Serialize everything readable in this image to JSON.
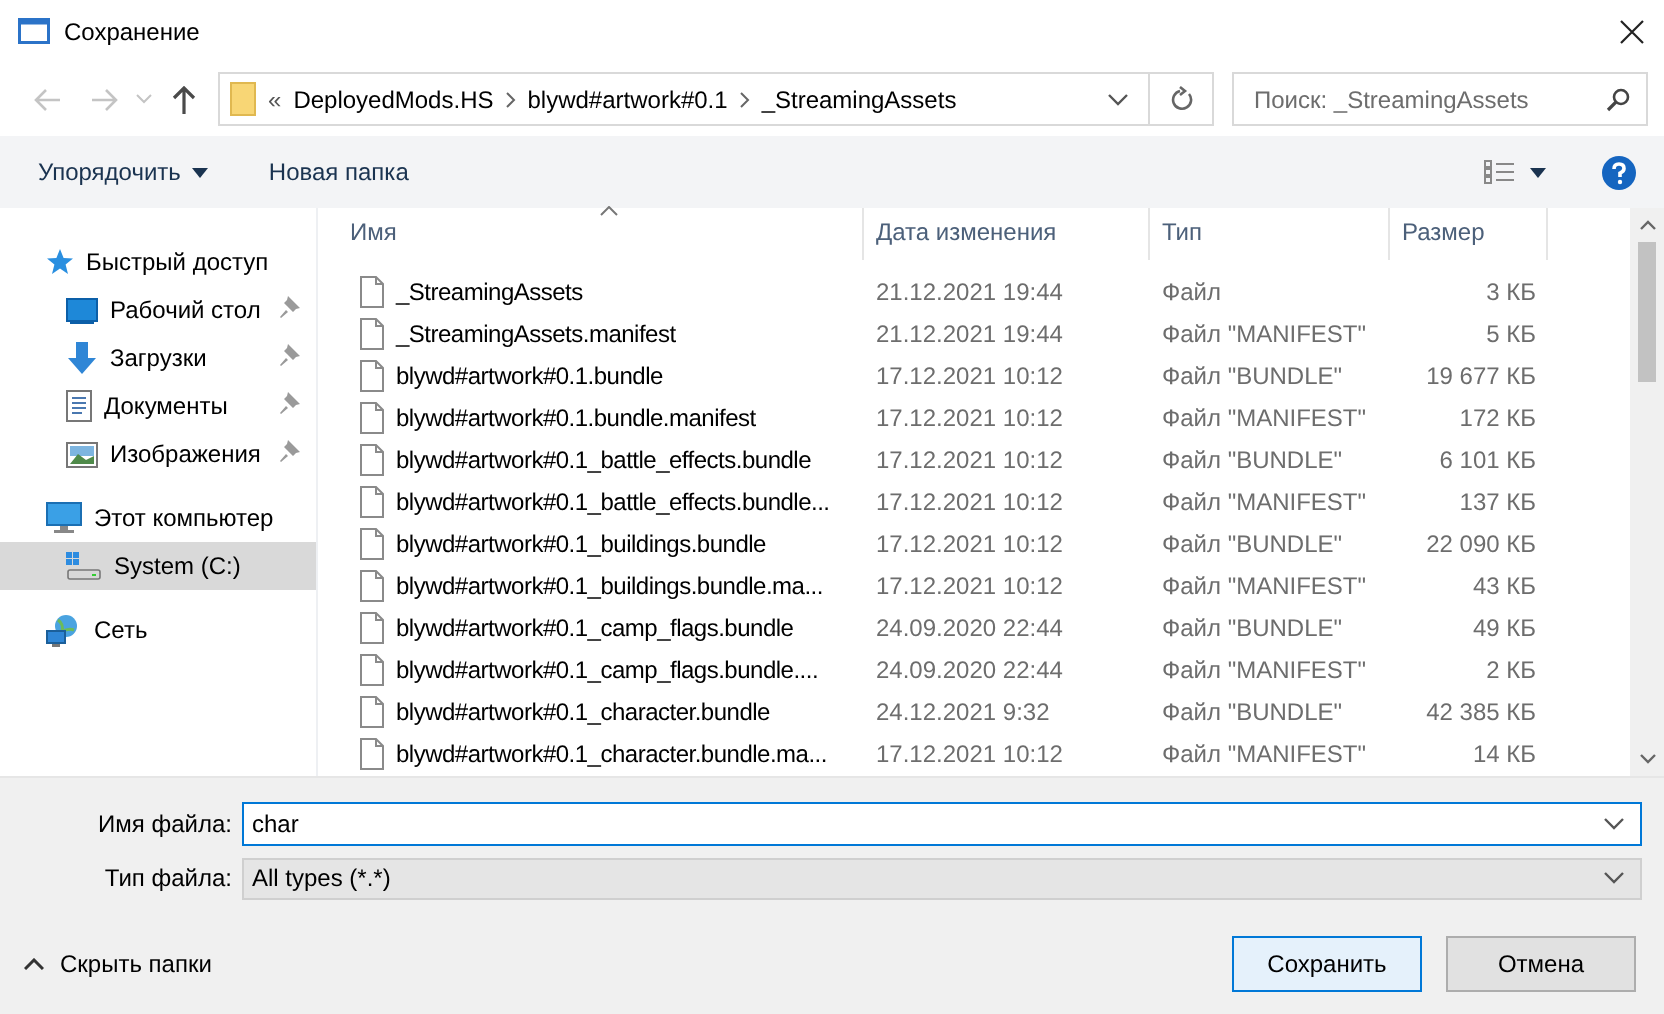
{
  "window": {
    "title": "Сохранение"
  },
  "navigation": {
    "back": {
      "disabled": true
    },
    "forward": {
      "disabled": true
    },
    "up": {
      "disabled": false
    }
  },
  "address": {
    "overflow": "«",
    "crumbs": [
      "DeployedMods.HS",
      "blywd#artwork#0.1",
      "_StreamingAssets"
    ]
  },
  "search": {
    "placeholder": "Поиск: _StreamingAssets"
  },
  "toolbar": {
    "organize": "Упорядочить",
    "new_folder": "Новая папка"
  },
  "sidebar": {
    "items": [
      {
        "label": "Быстрый доступ",
        "kind": "star",
        "selected": false,
        "children": [
          {
            "label": "Рабочий стол",
            "kind": "desktop",
            "pinned": true,
            "selected": false
          },
          {
            "label": "Загрузки",
            "kind": "download",
            "pinned": true,
            "selected": false
          },
          {
            "label": "Документы",
            "kind": "documents",
            "pinned": true,
            "selected": false
          },
          {
            "label": "Изображения",
            "kind": "pictures",
            "pinned": true,
            "selected": false
          }
        ]
      },
      {
        "label": "Этот компьютер",
        "kind": "computer",
        "selected": false,
        "children": [
          {
            "label": "System (C:)",
            "kind": "drive",
            "pinned": false,
            "selected": true
          }
        ]
      },
      {
        "label": "Сеть",
        "kind": "network",
        "selected": false
      }
    ]
  },
  "table": {
    "columns": [
      {
        "label": "Имя",
        "sorted": true
      },
      {
        "label": "Дата изменения",
        "sorted": false
      },
      {
        "label": "Тип",
        "sorted": false
      },
      {
        "label": "Размер",
        "sorted": false
      }
    ],
    "rows": [
      {
        "name": "_StreamingAssets",
        "date": "21.12.2021 19:44",
        "type": "Файл",
        "size": "3 КБ"
      },
      {
        "name": "_StreamingAssets.manifest",
        "date": "21.12.2021 19:44",
        "type": "Файл \"MANIFEST\"",
        "size": "5 КБ"
      },
      {
        "name": "blywd#artwork#0.1.bundle",
        "date": "17.12.2021 10:12",
        "type": "Файл \"BUNDLE\"",
        "size": "19 677 КБ"
      },
      {
        "name": "blywd#artwork#0.1.bundle.manifest",
        "date": "17.12.2021 10:12",
        "type": "Файл \"MANIFEST\"",
        "size": "172 КБ"
      },
      {
        "name": "blywd#artwork#0.1_battle_effects.bundle",
        "date": "17.12.2021 10:12",
        "type": "Файл \"BUNDLE\"",
        "size": "6 101 КБ"
      },
      {
        "name": "blywd#artwork#0.1_battle_effects.bundle...",
        "date": "17.12.2021 10:12",
        "type": "Файл \"MANIFEST\"",
        "size": "137 КБ"
      },
      {
        "name": "blywd#artwork#0.1_buildings.bundle",
        "date": "17.12.2021 10:12",
        "type": "Файл \"BUNDLE\"",
        "size": "22 090 КБ"
      },
      {
        "name": "blywd#artwork#0.1_buildings.bundle.ma...",
        "date": "17.12.2021 10:12",
        "type": "Файл \"MANIFEST\"",
        "size": "43 КБ"
      },
      {
        "name": "blywd#artwork#0.1_camp_flags.bundle",
        "date": "24.09.2020 22:44",
        "type": "Файл \"BUNDLE\"",
        "size": "49 КБ"
      },
      {
        "name": "blywd#artwork#0.1_camp_flags.bundle....",
        "date": "24.09.2020 22:44",
        "type": "Файл \"MANIFEST\"",
        "size": "2 КБ"
      },
      {
        "name": "blywd#artwork#0.1_character.bundle",
        "date": "24.12.2021 9:32",
        "type": "Файл \"BUNDLE\"",
        "size": "42 385 КБ"
      },
      {
        "name": "blywd#artwork#0.1_character.bundle.ma...",
        "date": "17.12.2021 10:12",
        "type": "Файл \"MANIFEST\"",
        "size": "14 КБ"
      }
    ]
  },
  "file_name": {
    "label": "Имя файла:",
    "value": "char"
  },
  "file_type": {
    "label": "Тип файла:",
    "value": "All types (*.*)"
  },
  "hide_folders": "Скрыть папки",
  "buttons": [
    {
      "label": "Сохранить",
      "default": true
    },
    {
      "label": "Отмена",
      "default": false
    }
  ]
}
